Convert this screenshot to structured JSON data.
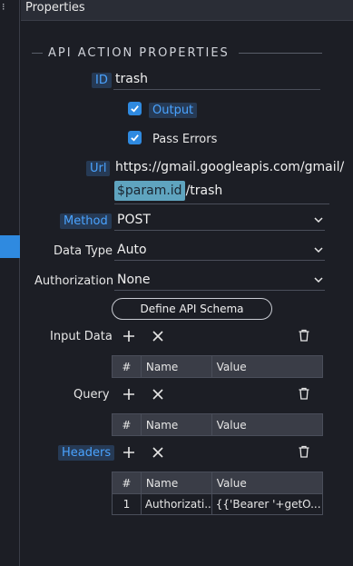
{
  "panel": {
    "title": "Properties"
  },
  "section": {
    "title": "API ACTION PROPERTIES"
  },
  "id_field": {
    "label": "ID",
    "value": "trash"
  },
  "output": {
    "label": "Output",
    "checked": true
  },
  "pass_errors": {
    "label": "Pass Errors",
    "checked": true
  },
  "url": {
    "label": "Url",
    "line1": "https://gmail.googleapis.com/gmail/",
    "param": "$param.id",
    "tail": "/trash"
  },
  "method": {
    "label": "Method",
    "value": "POST"
  },
  "data_type": {
    "label": "Data Type",
    "value": "Auto"
  },
  "authorization": {
    "label": "Authorization",
    "value": "None"
  },
  "schema_button": {
    "label": "Define API Schema"
  },
  "input_data": {
    "label": "Input Data",
    "columns": [
      "#",
      "Name",
      "Value"
    ]
  },
  "query": {
    "label": "Query",
    "columns": [
      "#",
      "Name",
      "Value"
    ]
  },
  "headers": {
    "label": "Headers",
    "columns": [
      "#",
      "Name",
      "Value"
    ],
    "rows": [
      {
        "num": "1",
        "name": "Authorizati...",
        "value": "{{'Bearer '+getO..."
      }
    ]
  },
  "colors": {
    "accent": "#2f8ae0",
    "background": "#1c1e25",
    "header": "#2a2d36",
    "label_highlight": "#4aa3ff",
    "param_chip": "#5fa4bf"
  },
  "icons": {
    "add": "plus-icon",
    "remove": "x-icon",
    "delete": "trash-icon",
    "dropdown": "chevron-down-icon",
    "check": "check-icon"
  }
}
